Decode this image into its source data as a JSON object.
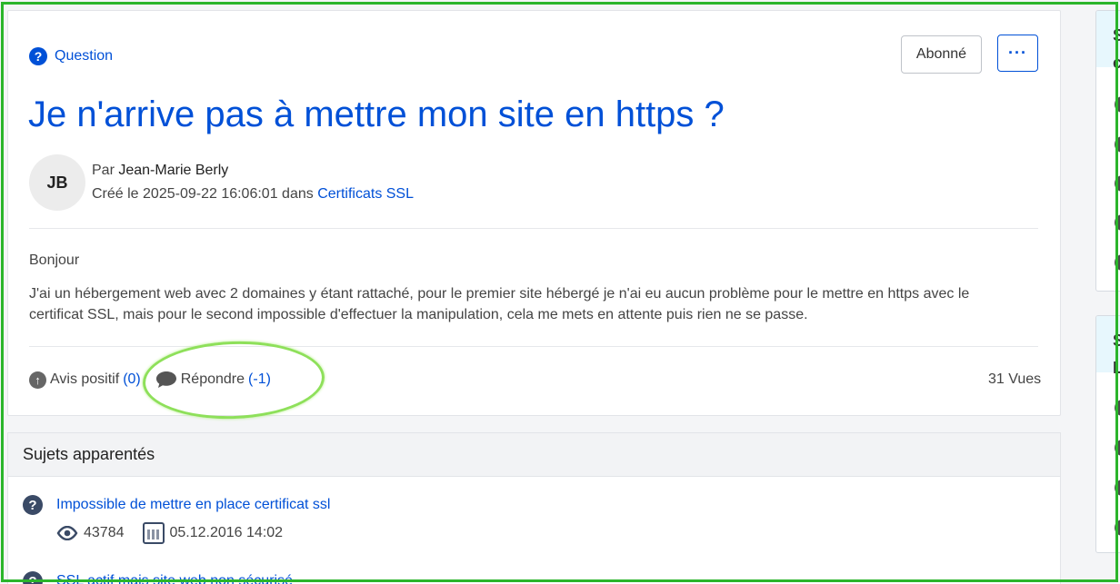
{
  "question": {
    "type_label": "Question",
    "subscribe_label": "Abonné",
    "more_label": "···",
    "title": "Je n'arrive pas à mettre mon site en https ?",
    "avatar_initials": "JB",
    "author_prefix": "Par",
    "author_name": "Jean-Marie Berly",
    "created_prefix": "Créé le 2025-09-22 16:06:01 dans",
    "category": "Certificats SSL",
    "greeting": "Bonjour",
    "body": "J'ai un hébergement web avec 2 domaines y étant rattaché, pour le premier site hébergé je n'ai eu aucun problème pour le mettre en https avec le certificat SSL, mais pour le second impossible d'effectuer la manipulation, cela me mets en attente puis rien ne se passe.",
    "upvote_label": "Avis positif",
    "upvote_count": "(0)",
    "reply_label": "Répondre",
    "reply_count": "(-1)",
    "views": "31 Vues"
  },
  "related": {
    "heading": "Sujets apparentés",
    "items": [
      {
        "title": "Impossible de mettre en place certificat ssl",
        "views": "43784",
        "date": "05.12.2016 14:02"
      },
      {
        "title": "SSL actif mais site web non sécurisé"
      }
    ]
  },
  "side_panels": [
    {
      "header": "S\nc"
    },
    {
      "header": "S\nL"
    }
  ],
  "colors": {
    "accent": "#0050d7",
    "highlight": "#8ee05a",
    "frame": "#2bb52b"
  }
}
